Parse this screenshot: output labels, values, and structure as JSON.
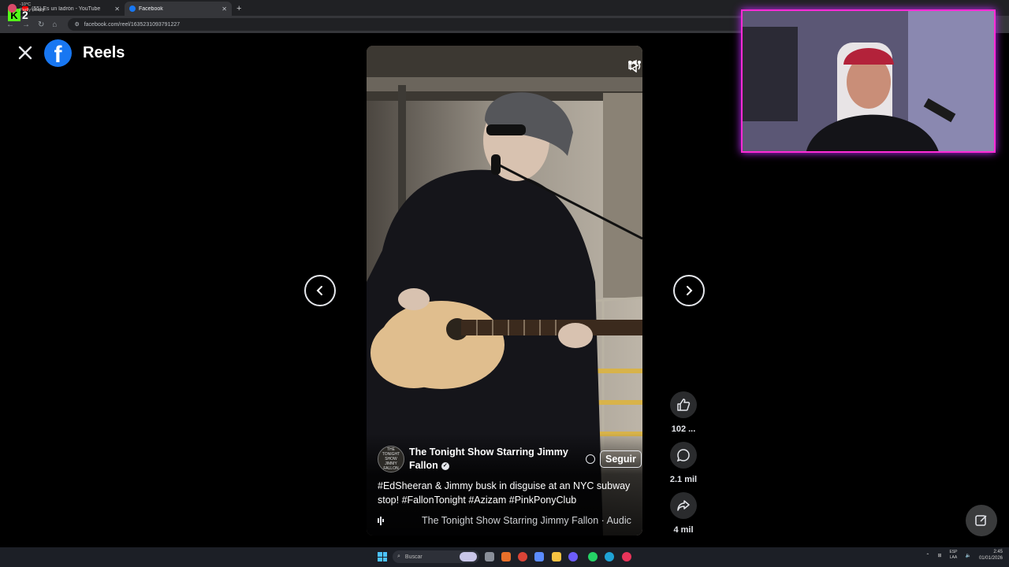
{
  "browser": {
    "tabs": [
      {
        "title": "(55) Es un ladrón - YouTube",
        "favicon": "youtube-icon",
        "active": false
      },
      {
        "title": "Facebook",
        "favicon": "facebook-icon",
        "active": true
      }
    ],
    "new_tab_label": "+",
    "url": "facebook.com/reel/1635231093791227"
  },
  "overlay_badge": {
    "letter": "K",
    "number": "2"
  },
  "header": {
    "title": "Reels"
  },
  "reel": {
    "author": "The Tonight Show Starring Jimmy Fallon",
    "avatar_text": "THE TONIGHT SHOW JIMMY FALLON",
    "follow_label": "Seguir",
    "caption": "#EdSheeran & Jimmy busk in disguise at an NYC subway stop! #FallonTonight #Azizam #PinkPonyClub",
    "audio": "The Tonight Show Starring Jimmy Fallon · Audic"
  },
  "actions": {
    "likes": "102 ...",
    "comments": "2.1 mil",
    "shares": "4 mil"
  },
  "taskbar": {
    "weather_temp": "-10°C",
    "weather_desc": "Partly cloudy",
    "search_placeholder": "Buscar",
    "lang_line1": "ESP",
    "lang_line2": "LAA",
    "time": "2:45",
    "date": "01/01/2026"
  },
  "colors": {
    "facebook_blue": "#1877f2",
    "kick_green": "#53fc18",
    "webcam_border": "#ff2bd6"
  }
}
